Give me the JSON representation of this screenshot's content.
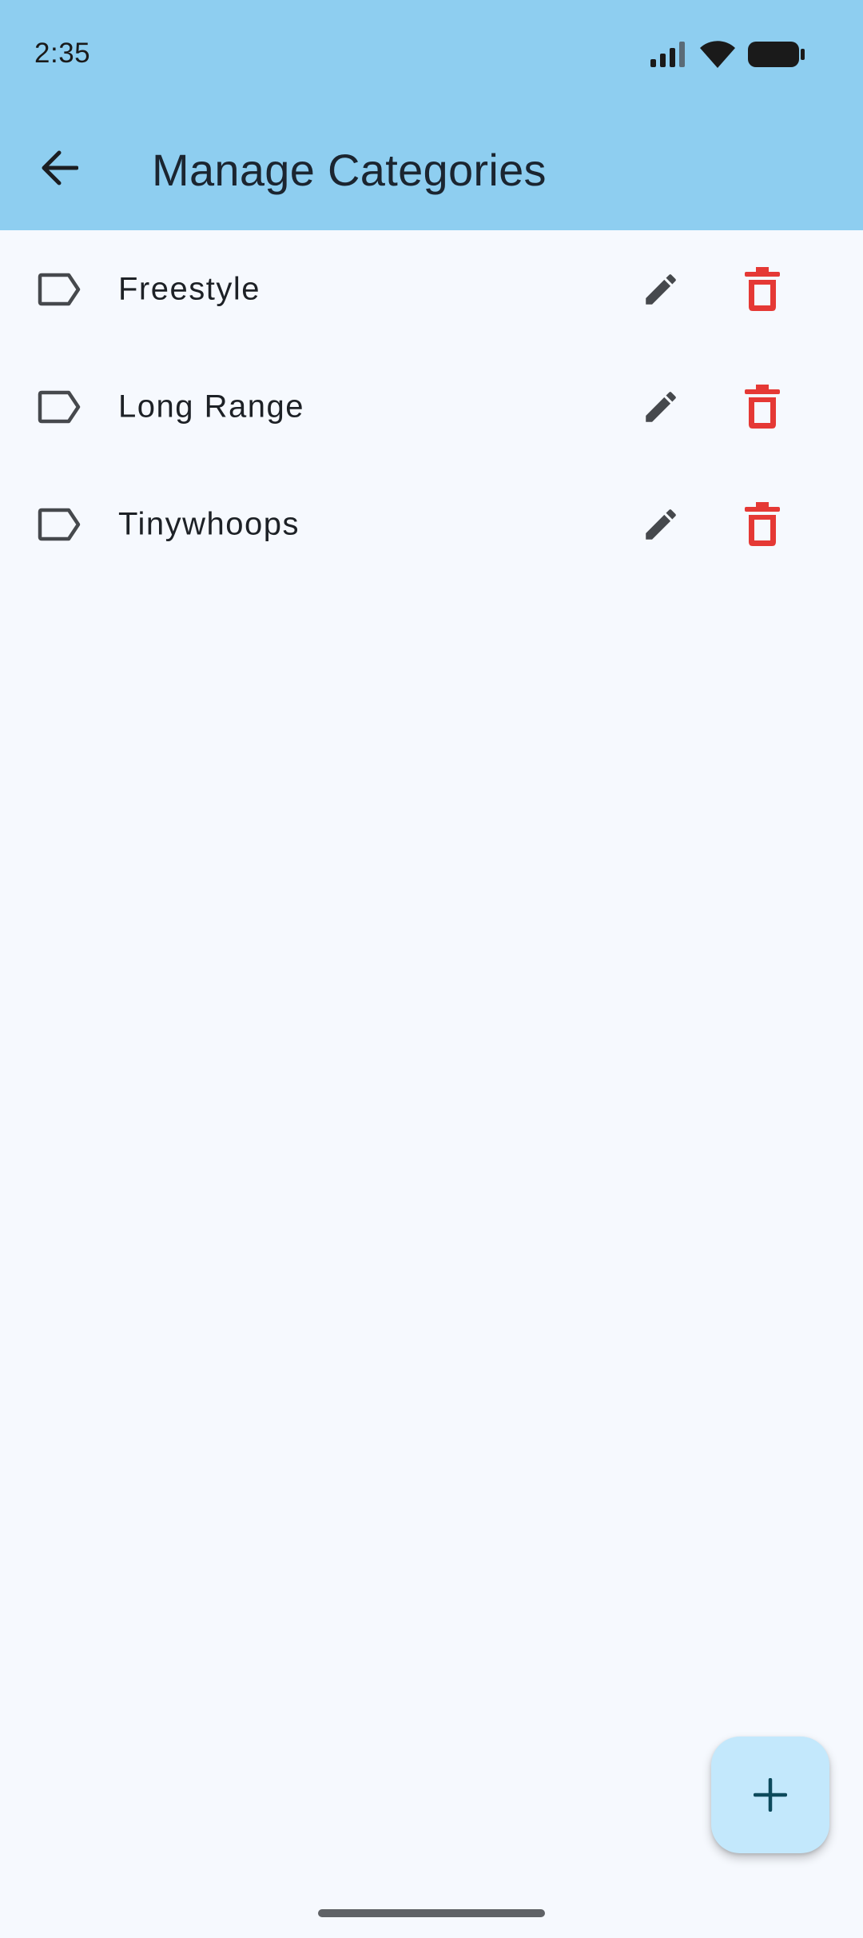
{
  "status_bar": {
    "time": "2:35"
  },
  "app_bar": {
    "title": "Manage Categories"
  },
  "categories": [
    {
      "name": "Freestyle"
    },
    {
      "name": "Long Range"
    },
    {
      "name": "Tinywhoops"
    }
  ],
  "icons": {
    "back": "arrow-back-icon",
    "category": "label-outline-icon",
    "edit": "pencil-icon",
    "delete": "trash-icon",
    "add": "plus-icon"
  },
  "colors": {
    "app_bar_bg": "#8ecef0",
    "background": "#f6f9fe",
    "delete_red": "#e53935",
    "icon_gray": "#46494d",
    "fab_bg": "#c3e8fc",
    "fab_icon": "#0d4a5c"
  }
}
